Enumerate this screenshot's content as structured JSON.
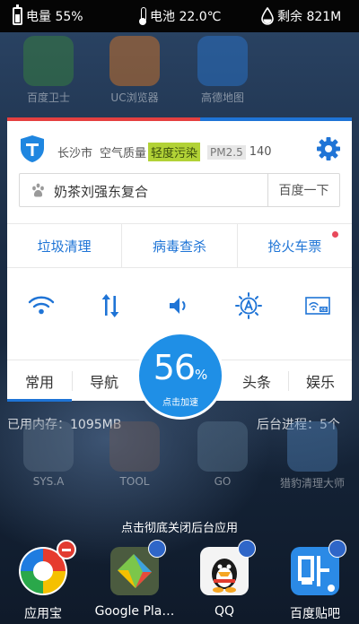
{
  "status_bar": {
    "battery_label": "电量 55%",
    "battery_level": 0.55,
    "temperature_label": "电池 22.0℃",
    "memory_label": "剩余 821M",
    "icons": [
      "battery-icon",
      "thermometer-icon",
      "water-drop-icon"
    ]
  },
  "background_apps": [
    {
      "label": "百度卫士",
      "color": "#3a8a3a"
    },
    {
      "label": "UC浏览器",
      "color": "#e77b20"
    },
    {
      "label": "高德地图",
      "color": "#2a7bd8"
    }
  ],
  "card": {
    "city": "长沙市",
    "air_quality_label": "空气质量",
    "air_quality_badge": "轻度污染",
    "pm_label": "PM2.5",
    "pm_value": "140",
    "search_value": "奶茶刘强东复合",
    "search_button": "百度一下",
    "quick_actions": [
      "垃圾清理",
      "病毒查杀",
      "抢火车票"
    ],
    "toggles": [
      "wifi-icon",
      "mobile-data-icon",
      "volume-icon",
      "auto-brightness-icon",
      "kb-icon"
    ],
    "tabs": [
      "常用",
      "导航",
      "头条",
      "娱乐"
    ],
    "accent_color": "#1e74d6",
    "badge_color": "#b2d236"
  },
  "boost": {
    "value": "56",
    "unit": "%",
    "sub_label": "点击加速"
  },
  "memory": {
    "used_label": "已用内存：",
    "used_value": "1095MB",
    "bg_process_label": "后台进程：",
    "bg_process_value": "5个"
  },
  "folders": [
    {
      "label": "SYS.A"
    },
    {
      "label": "TOOL"
    },
    {
      "label": "GO"
    },
    {
      "label": "猎豹清理大师"
    }
  ],
  "hint": "点击彻底关闭后台应用",
  "dock": [
    {
      "label": "应用宝",
      "badge": "minus-icon"
    },
    {
      "label": "Google Pla…",
      "badge": "lock-icon"
    },
    {
      "label": "QQ",
      "badge": "lock-icon"
    },
    {
      "label": "百度贴吧",
      "badge": "lock-icon"
    }
  ]
}
